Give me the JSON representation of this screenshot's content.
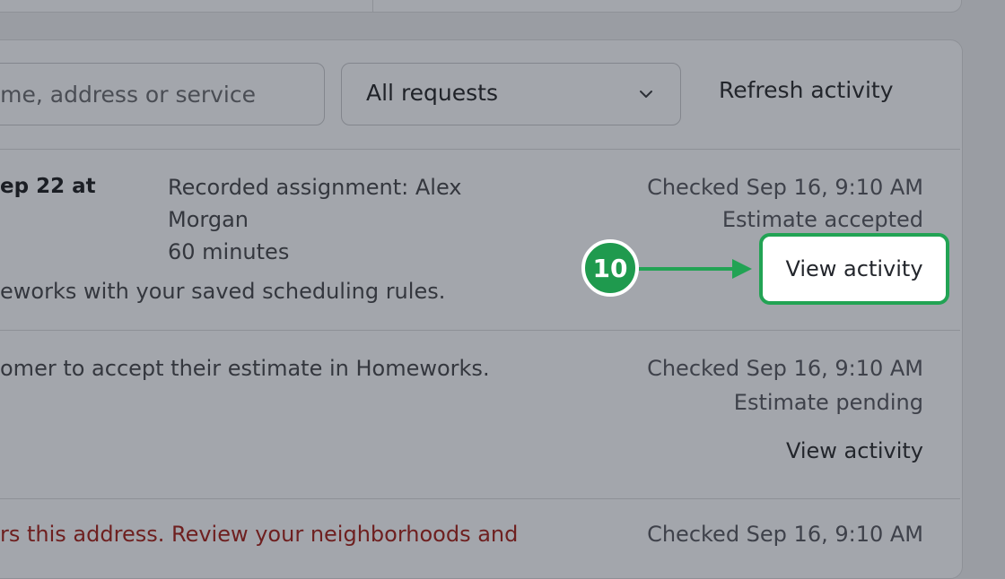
{
  "filters": {
    "search_placeholder": "me, address or service",
    "select_value": "All requests",
    "refresh_label": "Refresh activity"
  },
  "rows": [
    {
      "date_fragment": "ep 22 at",
      "assignment_line1": "Recorded assignment: Alex",
      "assignment_line2": "Morgan",
      "duration": "60 minutes",
      "note": "eworks with your saved scheduling rules.",
      "checked": "Checked Sep 16, 9:10 AM",
      "status": "Estimate accepted",
      "action": "View activity"
    },
    {
      "note": "omer to accept their estimate in Homeworks.",
      "checked": "Checked Sep 16, 9:10 AM",
      "status": "Estimate pending",
      "action": "View activity"
    },
    {
      "note": "rs this address. Review your neighborhoods and",
      "checked": "Checked Sep 16, 9:10 AM"
    }
  ],
  "annotation": {
    "step_number": "10",
    "color": "#22a354"
  },
  "icons": {
    "select": "chevron-down-icon",
    "annotation_arrow": "arrow-right-icon"
  }
}
